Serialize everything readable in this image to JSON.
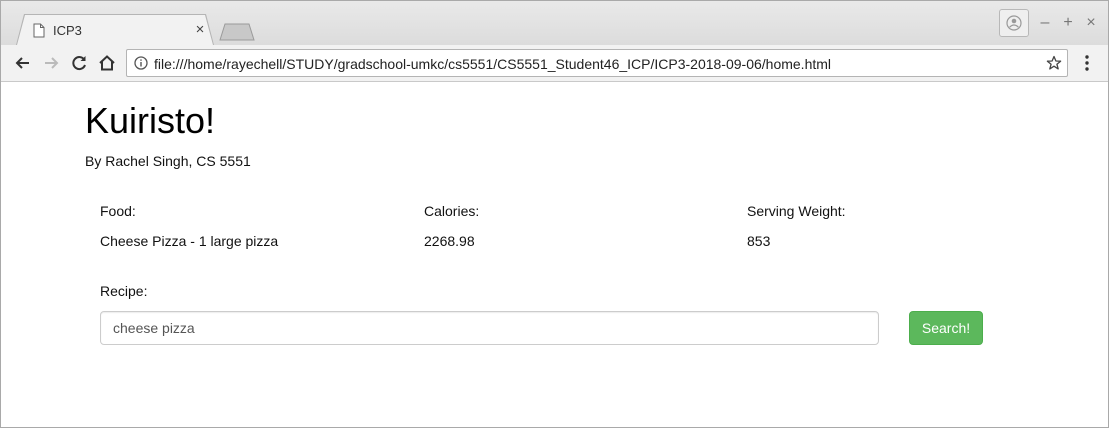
{
  "browser": {
    "tab_title": "ICP3",
    "tab_close": "×",
    "url": "file:///home/rayechell/STUDY/gradschool-umkc/cs5551/CS5551_Student46_ICP/ICP3-2018-09-06/home.html",
    "window_minimize": "–",
    "window_maximize": "+",
    "window_close": "×"
  },
  "page": {
    "title": "Kuiristo!",
    "byline": "By Rachel Singh, CS 5551",
    "nutrition": {
      "food_label": "Food:",
      "calories_label": "Calories:",
      "weight_label": "Serving Weight:",
      "food_value": "Cheese Pizza - 1 large pizza",
      "calories_value": "2268.98",
      "weight_value": "853"
    },
    "recipe_label": "Recipe:",
    "search_value": "cheese pizza",
    "search_button": "Search!"
  },
  "colors": {
    "button_green": "#5cb85c",
    "button_border": "#4cae4c"
  },
  "icons": [
    "page-icon",
    "back-arrow-icon",
    "forward-arrow-icon",
    "reload-icon",
    "home-icon",
    "info-icon",
    "star-icon",
    "menu-dots-icon",
    "profile-icon"
  ]
}
